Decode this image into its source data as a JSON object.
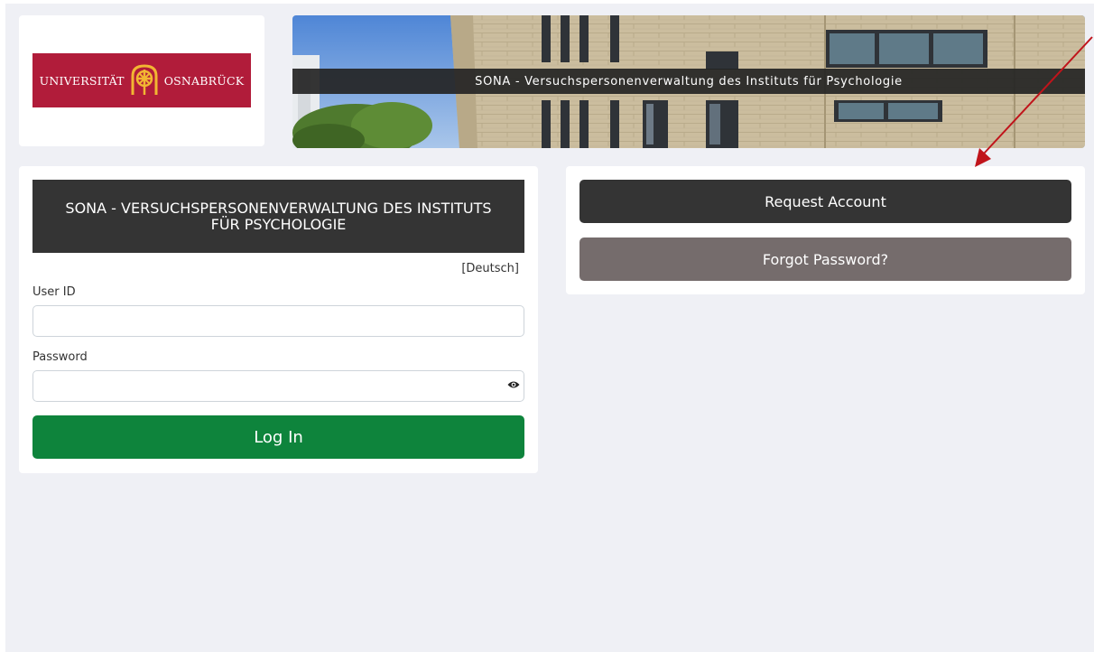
{
  "logo": {
    "left_text": "UNIVERSITÄT",
    "right_text": "OSNABRÜCK",
    "emblem": "osnabrueck-wheel-emblem-icon"
  },
  "banner": {
    "title": "SONA - Versuchspersonenverwaltung des Instituts für Psychologie"
  },
  "login": {
    "header": "SONA - VERSUCHSPERSONENVERWALTUNG DES INSTITUTS FÜR PSYCHOLOGIE",
    "language_link": "[Deutsch]",
    "user_id_label": "User ID",
    "user_id_value": "",
    "password_label": "Password",
    "password_value": "",
    "show_password_icon": "eye-icon",
    "submit_label": "Log In"
  },
  "account": {
    "request_label": "Request Account",
    "forgot_label": "Forgot Password?"
  },
  "colors": {
    "page_background": "#eff0f5",
    "dark_button": "#343434",
    "forgot_button": "#756c6c",
    "login_button": "#0e843c",
    "logo_red": "#b11c3a",
    "annotation_arrow": "#c0141b"
  }
}
